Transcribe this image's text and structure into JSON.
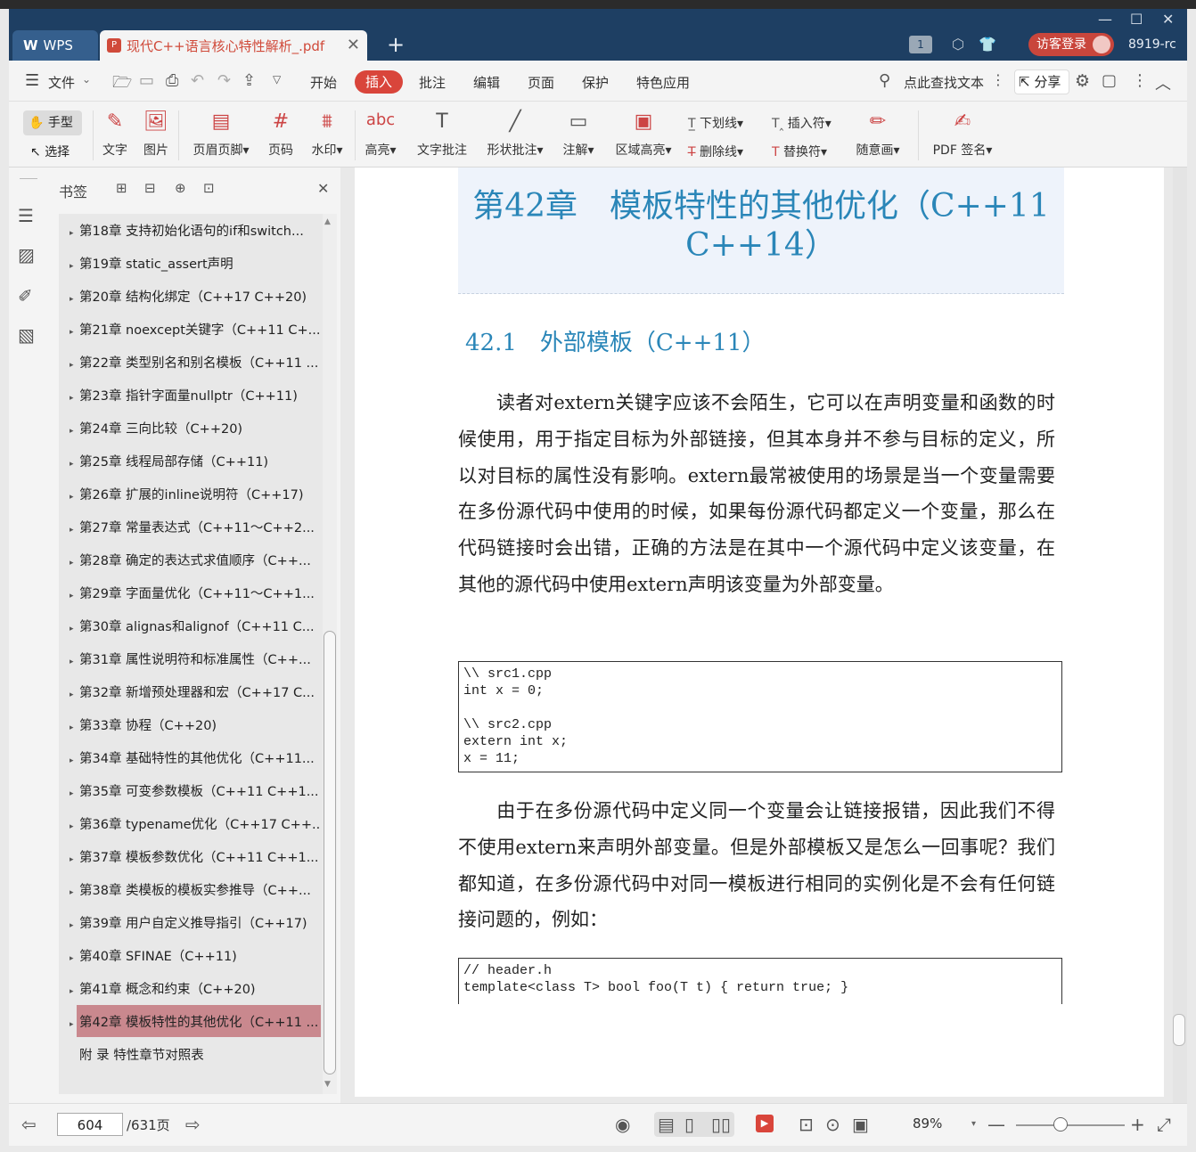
{
  "tabs": {
    "app": "WPS",
    "document": "现代C++语言核心特性解析_.pdf"
  },
  "titlebar": {
    "page_count_badge": "1",
    "visitor_login": "访客登录",
    "version": "8919-rc"
  },
  "menu": {
    "file": "文件",
    "items": [
      "开始",
      "插入",
      "批注",
      "编辑",
      "页面",
      "保护",
      "特色应用"
    ],
    "active": "插入",
    "search": "点此查找文本",
    "share": "分享"
  },
  "ribbon": {
    "hand": "手型",
    "select": "选择",
    "text": "文字",
    "image": "图片",
    "header_footer": "页眉页脚",
    "page_num": "页码",
    "watermark": "水印",
    "highlight": "高亮",
    "text_annot": "文字批注",
    "shape_annot": "形状批注",
    "note": "注解",
    "area_highlight": "区域高亮",
    "underline": "下划线",
    "strikethrough": "删除线",
    "insert_mark": "插入符",
    "replace_mark": "替换符",
    "freehand": "随意画",
    "pdf_sign": "PDF 签名"
  },
  "sidebar": {
    "title": "书签",
    "items": [
      "第18章 支持初始化语句的if和switch...",
      "第19章 static_assert声明",
      "第20章 结构化绑定（C++17 C++20)",
      "第21章 noexcept关键字（C++11 C+...",
      "第22章 类型别名和别名模板（C++11 ...",
      "第23章 指针字面量nullptr（C++11)",
      "第24章 三向比较（C++20)",
      "第25章 线程局部存储（C++11)",
      "第26章 扩展的inline说明符（C++17)",
      "第27章 常量表达式（C++11～C++2...",
      "第28章 确定的表达式求值顺序（C++...",
      "第29章 字面量优化（C++11～C++1...",
      "第30章 alignas和alignof（C++11 C...",
      "第31章 属性说明符和标准属性（C++...",
      "第32章 新增预处理器和宏（C++17 C...",
      "第33章 协程（C++20)",
      "第34章 基础特性的其他优化（C++11...",
      "第35章 可变参数模板（C++11 C++1...",
      "第36章 typename优化（C++17 C++...",
      "第37章 模板参数优化（C++11 C++1...",
      "第38章 类模板的模板实参推导（C++...",
      "第39章 用户自定义推导指引（C++17)",
      "第40章 SFINAE（C++11)",
      "第41章 概念和约束（C++20)",
      "第42章 模板特性的其他优化（C++11 ...",
      "附 录 特性章节对照表"
    ]
  },
  "document": {
    "chapter_title_line1": "第42章　模板特性的其他优化（C++11",
    "chapter_title_line2": "C++14）",
    "section_title": "42.1　外部模板（C++11）",
    "para1": "　　读者对extern关键字应该不会陌生，它可以在声明变量和函数的时候使用，用于指定目标为外部链接，但其本身并不参与目标的定义，所以对目标的属性没有影响。extern最常被使用的场景是当一个变量需要在多份源代码中使用的时候，如果每份源代码都定义一个变量，那么在代码链接时会出错，正确的方法是在其中一个源代码中定义该变量，在其他的源代码中使用extern声明该变量为外部变量。",
    "code1": "\\\\ src1.cpp\nint x = 0;\n\n\\\\ src2.cpp\nextern int x;\nx = 11;",
    "para2": "　　由于在多份源代码中定义同一个变量会让链接报错，因此我们不得不使用extern来声明外部变量。但是外部模板又是怎么一回事呢？我们都知道，在多份源代码中对同一模板进行相同的实例化是不会有任何链接问题的，例如：",
    "code2": "// header.h\ntemplate<class T> bool foo(T t) { return true; }"
  },
  "statusbar": {
    "current_page": "604",
    "total_pages": "/631页",
    "zoom": "89%"
  },
  "colors": {
    "accent": "#d9453b",
    "title_blue": "#2a86b8",
    "tabbar": "#2e5a85",
    "bookmark_active": "#c9888e"
  }
}
